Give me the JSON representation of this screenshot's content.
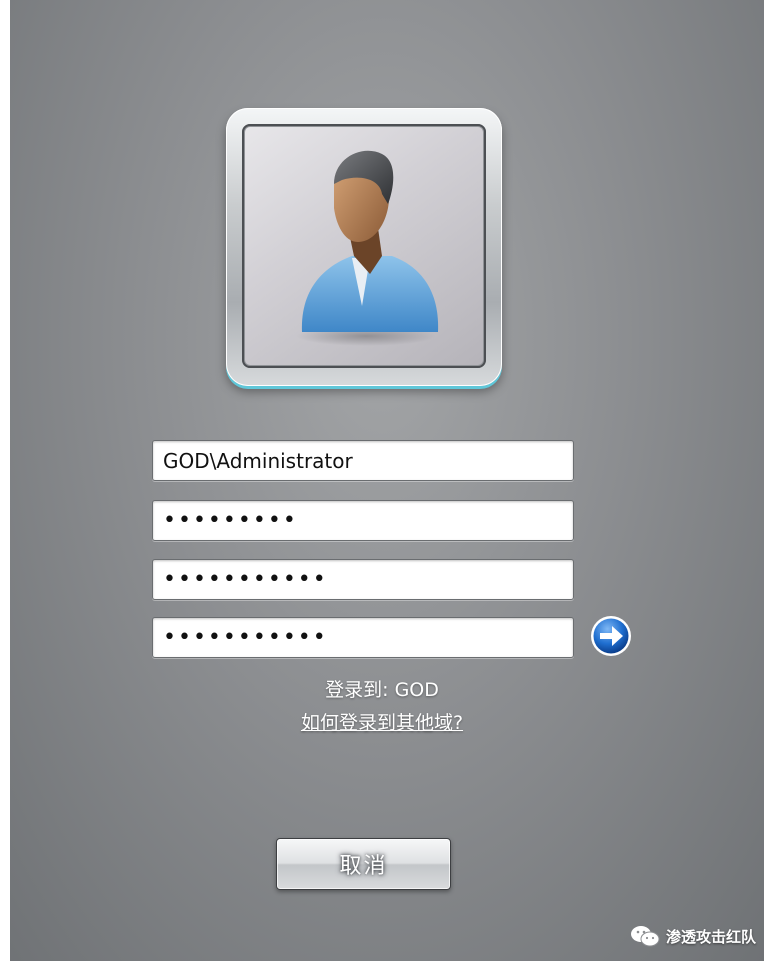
{
  "login": {
    "username_value": "GOD\\Administrator",
    "password_value": "•••••••••",
    "new_password_value": "•••••••••••",
    "confirm_password_value": "•••••••••••",
    "login_to_prefix": "登录到: ",
    "domain": "GOD",
    "other_domain_link": "如何登录到其他域?",
    "cancel_label": "取消"
  },
  "icons": {
    "avatar": "user-avatar-icon",
    "submit": "arrow-right-icon",
    "watermark": "wechat-icon"
  },
  "colors": {
    "background": "#8c8e91",
    "accent": "#5fc7d9",
    "submit_blue": "#1f6fd0"
  },
  "watermark": {
    "text": "渗透攻击红队"
  }
}
